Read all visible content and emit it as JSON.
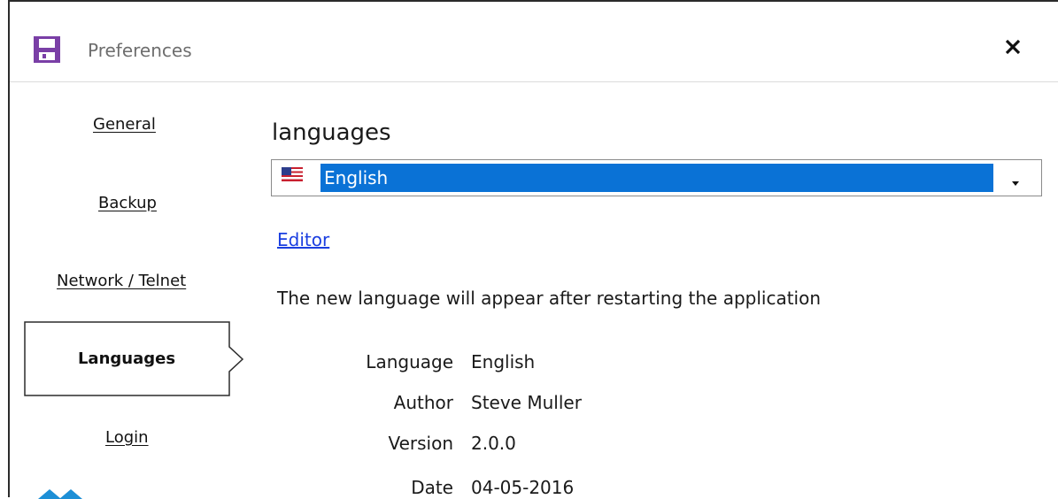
{
  "window": {
    "title": "Preferences"
  },
  "nav": {
    "items": [
      {
        "label": "General"
      },
      {
        "label": "Backup"
      },
      {
        "label": "Network / Telnet"
      },
      {
        "label": "Languages",
        "active": true
      },
      {
        "label": "Login"
      }
    ]
  },
  "languages": {
    "section_title": "languages",
    "selected_language": "English",
    "editor_link": "Editor",
    "restart_note": "The new language will appear after restarting the application",
    "info": {
      "language_label": "Language",
      "language_value": "English",
      "author_label": "Author",
      "author_value": "Steve Muller",
      "version_label": "Version",
      "version_value": "2.0.0",
      "date_label": "Date",
      "date_value": "04-05-2016"
    }
  },
  "icons": {
    "title": "floppy-disk-icon",
    "close": "close-icon",
    "flag": "us-flag-icon",
    "dropdown": "chevron-down-icon"
  },
  "colors": {
    "accent_purple": "#7a3fa6",
    "selection_blue": "#0a72d6",
    "link_blue": "#1a3ee0",
    "logo_blue": "#1d8fd6"
  }
}
